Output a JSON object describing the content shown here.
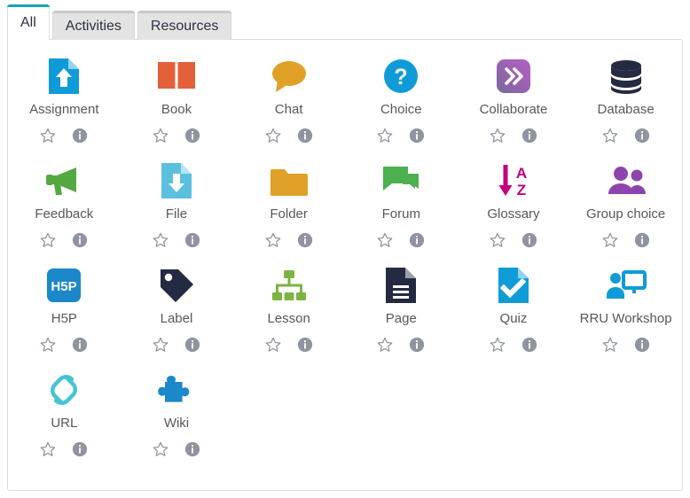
{
  "tabs": [
    {
      "label": "All",
      "active": true
    },
    {
      "label": "Activities",
      "active": false
    },
    {
      "label": "Resources",
      "active": false
    }
  ],
  "colors": {
    "active_tab_accent": "#17a2b8",
    "panel_border": "#dedede",
    "label_text": "#55585c",
    "action_icon": "#8f959e"
  },
  "actions": {
    "favourite_label": "star-outline-icon",
    "info_label": "info-circle-icon"
  },
  "items": [
    {
      "label": "Assignment",
      "icon": "assignment-icon",
      "color": "#0f9bd7"
    },
    {
      "label": "Book",
      "icon": "book-icon",
      "color": "#e2613b"
    },
    {
      "label": "Chat",
      "icon": "chat-icon",
      "color": "#e0a028"
    },
    {
      "label": "Choice",
      "icon": "choice-icon",
      "color": "#0f9bd7"
    },
    {
      "label": "Collaborate",
      "icon": "collaborate-icon",
      "color": "#9b59b6"
    },
    {
      "label": "Database",
      "icon": "database-icon",
      "color": "#242a41"
    },
    {
      "label": "Feedback",
      "icon": "feedback-icon",
      "color": "#53a93f"
    },
    {
      "label": "File",
      "icon": "file-icon",
      "color": "#5bc0de"
    },
    {
      "label": "Folder",
      "icon": "folder-icon",
      "color": "#e0a028"
    },
    {
      "label": "Forum",
      "icon": "forum-icon",
      "color": "#4caf50"
    },
    {
      "label": "Glossary",
      "icon": "glossary-icon",
      "color": "#c2007b"
    },
    {
      "label": "Group choice",
      "icon": "group-choice-icon",
      "color": "#8e44ad"
    },
    {
      "label": "H5P",
      "icon": "h5p-icon",
      "color": "#1a88c9"
    },
    {
      "label": "Label",
      "icon": "label-icon",
      "color": "#242a41"
    },
    {
      "label": "Lesson",
      "icon": "lesson-icon",
      "color": "#7cb342"
    },
    {
      "label": "Page",
      "icon": "page-icon",
      "color": "#242a41"
    },
    {
      "label": "Quiz",
      "icon": "quiz-icon",
      "color": "#0f9bd7"
    },
    {
      "label": "RRU Workshop",
      "icon": "rru-workshop-icon",
      "color": "#0f9bd7"
    },
    {
      "label": "URL",
      "icon": "url-icon",
      "color": "#45c3d6"
    },
    {
      "label": "Wiki",
      "icon": "wiki-icon",
      "color": "#1a88c9"
    }
  ]
}
